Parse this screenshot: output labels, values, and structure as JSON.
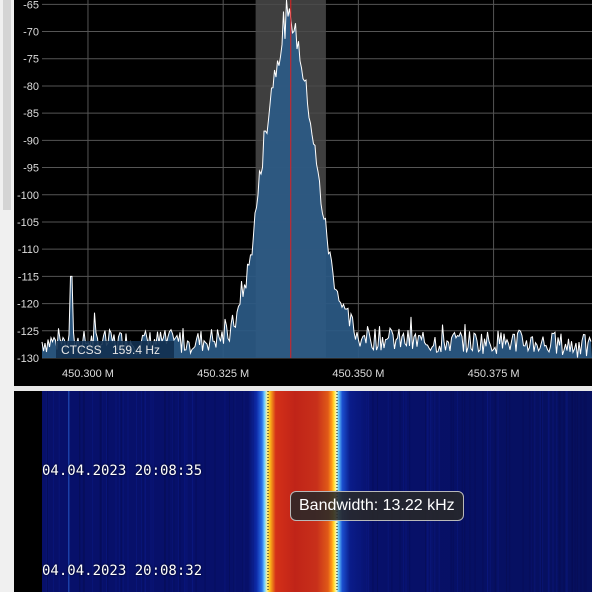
{
  "spectrum": {
    "db_ticks": [
      "-65",
      "-70",
      "-75",
      "-80",
      "-85",
      "-90",
      "-95",
      "-100",
      "-105",
      "-110",
      "-115",
      "-120",
      "-125",
      "-130"
    ],
    "freq_ticks": [
      "450.300 M",
      "450.325 M",
      "450.350 M",
      "450.375 M"
    ],
    "ctcss_label": "CTCSS",
    "ctcss_value": "159.4 Hz"
  },
  "chart_data": {
    "type": "area",
    "title": "",
    "xlabel": "",
    "ylabel": "",
    "x_unit": "MHz",
    "y_unit": "dB",
    "ylim": [
      -130,
      -62
    ],
    "xlim": [
      450.2915,
      450.3932
    ],
    "grid": true,
    "series": [
      {
        "x": [
          450.2915,
          450.3,
          450.312,
          450.32,
          450.326,
          450.328,
          450.33,
          450.332,
          450.334,
          450.336,
          450.3375,
          450.339,
          450.341,
          450.343,
          450.345,
          450.347,
          450.35,
          450.36,
          450.37,
          450.38,
          450.3932
        ],
        "values": [
          -127,
          -127,
          -127,
          -127,
          -126,
          -121,
          -112,
          -95,
          -80,
          -71,
          -67,
          -73,
          -85,
          -100,
          -113,
          -121,
          -126,
          -127,
          -127,
          -127,
          -128
        ]
      }
    ],
    "annotations": [
      {
        "type": "marker",
        "x": 450.3375
      },
      {
        "type": "filter_band",
        "from": 450.331,
        "to": 450.344
      },
      {
        "type": "spike",
        "x": 450.297,
        "y": -115
      }
    ]
  },
  "waterfall": {
    "timestamps": [
      "04.04.2023 20:08:35",
      "04.04.2023 20:08:32"
    ],
    "tooltip": "Bandwidth: 13.22 kHz"
  }
}
